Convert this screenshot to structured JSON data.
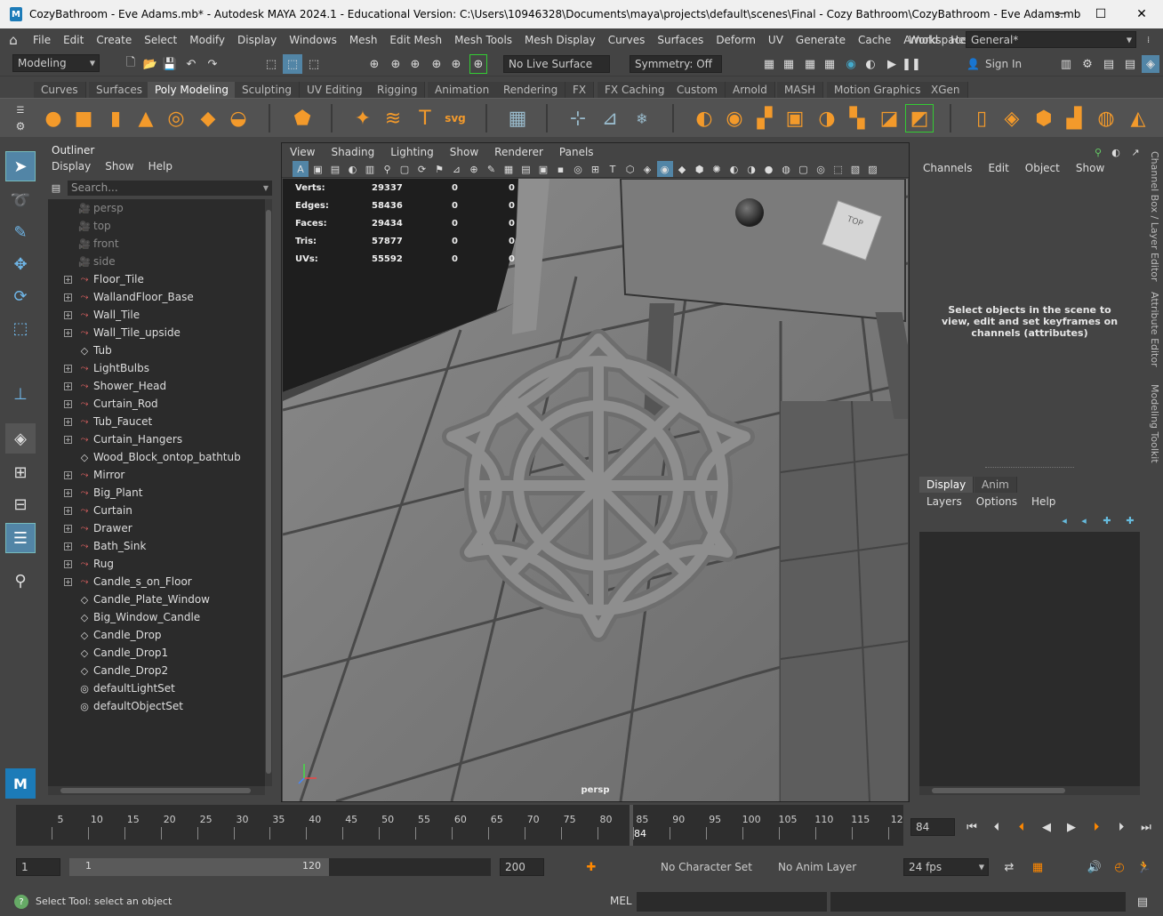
{
  "window": {
    "title": "CozyBathroom - Eve Adams.mb* - Autodesk MAYA 2024.1 - Educational Version: C:\\Users\\10946328\\Documents\\maya\\projects\\default\\scenes\\Final - Cozy Bathroom\\CozyBathroom - Eve Adams.mb",
    "app_icon": "M",
    "minimize": "─",
    "maximize": "☐",
    "close": "✕"
  },
  "menubar": {
    "items": [
      "File",
      "Edit",
      "Create",
      "Select",
      "Modify",
      "Display",
      "Windows",
      "Mesh",
      "Edit Mesh",
      "Mesh Tools",
      "Mesh Display",
      "Curves",
      "Surfaces",
      "Deform",
      "UV",
      "Generate",
      "Cache",
      "Arnold",
      "Help"
    ],
    "workspace_label": "Workspace:",
    "workspace_value": "General*"
  },
  "statusline": {
    "mode": "Modeling",
    "live_surface": "No Live Surface",
    "symmetry": "Symmetry: Off",
    "sign_in": "Sign In"
  },
  "shelf": {
    "tabs": [
      "Curves",
      "Surfaces",
      "Poly Modeling",
      "Sculpting",
      "UV Editing",
      "Rigging",
      "Animation",
      "Rendering",
      "FX",
      "FX Caching",
      "Custom",
      "Arnold",
      "MASH",
      "Motion Graphics",
      "XGen"
    ],
    "active_tab": "Poly Modeling",
    "icon_color": "#f39a2b"
  },
  "outliner": {
    "title": "Outliner",
    "menu": [
      "Display",
      "Show",
      "Help"
    ],
    "search_placeholder": "Search...",
    "items": [
      {
        "name": "persp",
        "type": "camera",
        "expand": false,
        "dim": true
      },
      {
        "name": "top",
        "type": "camera",
        "expand": false,
        "dim": true
      },
      {
        "name": "front",
        "type": "camera",
        "expand": false,
        "dim": true
      },
      {
        "name": "side",
        "type": "camera",
        "expand": false,
        "dim": true
      },
      {
        "name": "Floor_Tile",
        "type": "group",
        "expand": true
      },
      {
        "name": "WallandFloor_Base",
        "type": "group",
        "expand": true
      },
      {
        "name": "Wall_Tile",
        "type": "group",
        "expand": true
      },
      {
        "name": "Wall_Tile_upside",
        "type": "group",
        "expand": true
      },
      {
        "name": "Tub",
        "type": "mesh",
        "expand": false
      },
      {
        "name": "LightBulbs",
        "type": "group",
        "expand": true
      },
      {
        "name": "Shower_Head",
        "type": "group",
        "expand": true
      },
      {
        "name": "Curtain_Rod",
        "type": "group",
        "expand": true
      },
      {
        "name": "Tub_Faucet",
        "type": "group",
        "expand": true
      },
      {
        "name": "Curtain_Hangers",
        "type": "group",
        "expand": true
      },
      {
        "name": "Wood_Block_ontop_bathtub",
        "type": "mesh",
        "expand": false
      },
      {
        "name": "Mirror",
        "type": "group",
        "expand": true
      },
      {
        "name": "Big_Plant",
        "type": "group",
        "expand": true
      },
      {
        "name": "Curtain",
        "type": "group",
        "expand": true
      },
      {
        "name": "Drawer",
        "type": "group",
        "expand": true
      },
      {
        "name": "Bath_Sink",
        "type": "group",
        "expand": true
      },
      {
        "name": "Rug",
        "type": "group",
        "expand": true
      },
      {
        "name": "Candle_s_on_Floor",
        "type": "group",
        "expand": true
      },
      {
        "name": "Candle_Plate_Window",
        "type": "mesh",
        "expand": false
      },
      {
        "name": "Big_Window_Candle",
        "type": "mesh",
        "expand": false
      },
      {
        "name": "Candle_Drop",
        "type": "mesh",
        "expand": false
      },
      {
        "name": "Candle_Drop1",
        "type": "mesh",
        "expand": false
      },
      {
        "name": "Candle_Drop2",
        "type": "mesh",
        "expand": false
      },
      {
        "name": "defaultLightSet",
        "type": "set",
        "expand": false
      },
      {
        "name": "defaultObjectSet",
        "type": "set",
        "expand": false
      }
    ]
  },
  "viewport": {
    "menu": [
      "View",
      "Shading",
      "Lighting",
      "Show",
      "Renderer",
      "Panels"
    ],
    "camera_label": "persp",
    "viewcube_label": "TOP",
    "hud": [
      {
        "label": "Verts:",
        "a": "29337",
        "b": "0",
        "c": "0"
      },
      {
        "label": "Edges:",
        "a": "58436",
        "b": "0",
        "c": "0"
      },
      {
        "label": "Faces:",
        "a": "29434",
        "b": "0",
        "c": "0"
      },
      {
        "label": "Tris:",
        "a": "57877",
        "b": "0",
        "c": "0"
      },
      {
        "label": "UVs:",
        "a": "55592",
        "b": "0",
        "c": "0"
      }
    ]
  },
  "channel_box": {
    "menu": [
      "Channels",
      "Edit",
      "Object",
      "Show"
    ],
    "hint": "Select objects in the scene to view, edit and set keyframes on channels (attributes)",
    "layer_tabs": [
      "Display",
      "Anim"
    ],
    "layer_menu": [
      "Layers",
      "Options",
      "Help"
    ]
  },
  "side_tabs": [
    "Channel Box / Layer Editor",
    "Attribute Editor",
    "Modeling Toolkit"
  ],
  "timeline": {
    "ticks": [
      "5",
      "10",
      "15",
      "20",
      "25",
      "30",
      "35",
      "40",
      "45",
      "50",
      "55",
      "60",
      "65",
      "70",
      "75",
      "80",
      "85",
      "90",
      "95",
      "100",
      "105",
      "110",
      "115",
      "12"
    ],
    "current_frame": "84",
    "current_frame_field": "84"
  },
  "range": {
    "start": "1",
    "inner_start": "1",
    "inner_end": "120",
    "end": "200",
    "character_set": "No Character Set",
    "anim_layer": "No Anim Layer",
    "fps": "24 fps"
  },
  "command": {
    "help": "Select Tool: select an object",
    "lang": "MEL"
  }
}
